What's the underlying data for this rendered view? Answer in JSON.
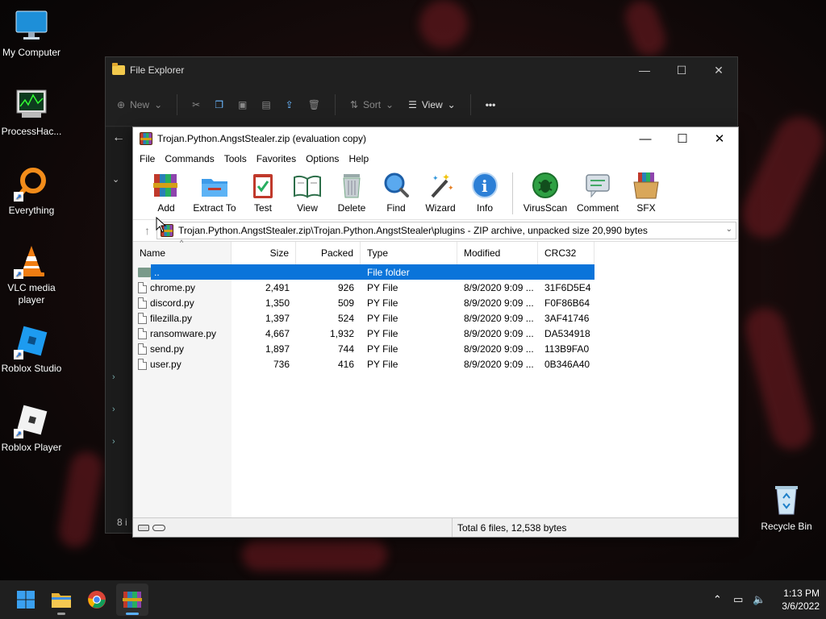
{
  "desktop": {
    "icons": [
      {
        "label": "My Computer",
        "icon": "monitor-icon"
      },
      {
        "label": "ProcessHac...",
        "icon": "process-hacker-icon"
      },
      {
        "label": "Everything",
        "icon": "everything-search-icon"
      },
      {
        "label": "VLC media player",
        "icon": "vlc-cone-icon"
      },
      {
        "label": "Roblox Studio",
        "icon": "roblox-studio-icon"
      },
      {
        "label": "Roblox Player",
        "icon": "roblox-player-icon"
      },
      {
        "label": "Recycle Bin",
        "icon": "recycle-bin-icon"
      }
    ]
  },
  "explorer": {
    "title": "File Explorer",
    "toolbar": {
      "new": "New",
      "sort": "Sort",
      "view": "View",
      "more": "•••"
    },
    "status_stub": "8 i"
  },
  "winrar": {
    "title": "Trojan.Python.AngstStealer.zip (evaluation copy)",
    "menu": [
      "File",
      "Commands",
      "Tools",
      "Favorites",
      "Options",
      "Help"
    ],
    "tools": [
      "Add",
      "Extract To",
      "Test",
      "View",
      "Delete",
      "Find",
      "Wizard",
      "Info",
      "VirusScan",
      "Comment",
      "SFX"
    ],
    "path": "Trojan.Python.AngstStealer.zip\\Trojan.Python.AngstStealer\\plugins - ZIP archive, unpacked size 20,990 bytes",
    "columns": {
      "name": "Name",
      "size": "Size",
      "packed": "Packed",
      "type": "Type",
      "modified": "Modified",
      "crc": "CRC32"
    },
    "parent_row": {
      "name": "..",
      "type": "File folder"
    },
    "files": [
      {
        "name": "chrome.py",
        "size": "2,491",
        "packed": "926",
        "type": "PY File",
        "modified": "8/9/2020 9:09 ...",
        "crc": "31F6D5E4"
      },
      {
        "name": "discord.py",
        "size": "1,350",
        "packed": "509",
        "type": "PY File",
        "modified": "8/9/2020 9:09 ...",
        "crc": "F0F86B64"
      },
      {
        "name": "filezilla.py",
        "size": "1,397",
        "packed": "524",
        "type": "PY File",
        "modified": "8/9/2020 9:09 ...",
        "crc": "3AF41746"
      },
      {
        "name": "ransomware.py",
        "size": "4,667",
        "packed": "1,932",
        "type": "PY File",
        "modified": "8/9/2020 9:09 ...",
        "crc": "DA534918"
      },
      {
        "name": "send.py",
        "size": "1,897",
        "packed": "744",
        "type": "PY File",
        "modified": "8/9/2020 9:09 ...",
        "crc": "113B9FA0"
      },
      {
        "name": "user.py",
        "size": "736",
        "packed": "416",
        "type": "PY File",
        "modified": "8/9/2020 9:09 ...",
        "crc": "0B346A40"
      }
    ],
    "status": "Total 6 files, 12,538 bytes"
  },
  "taskbar": {
    "time": "1:13 PM",
    "date": "3/6/2022",
    "accent": "#5ab0ff"
  }
}
